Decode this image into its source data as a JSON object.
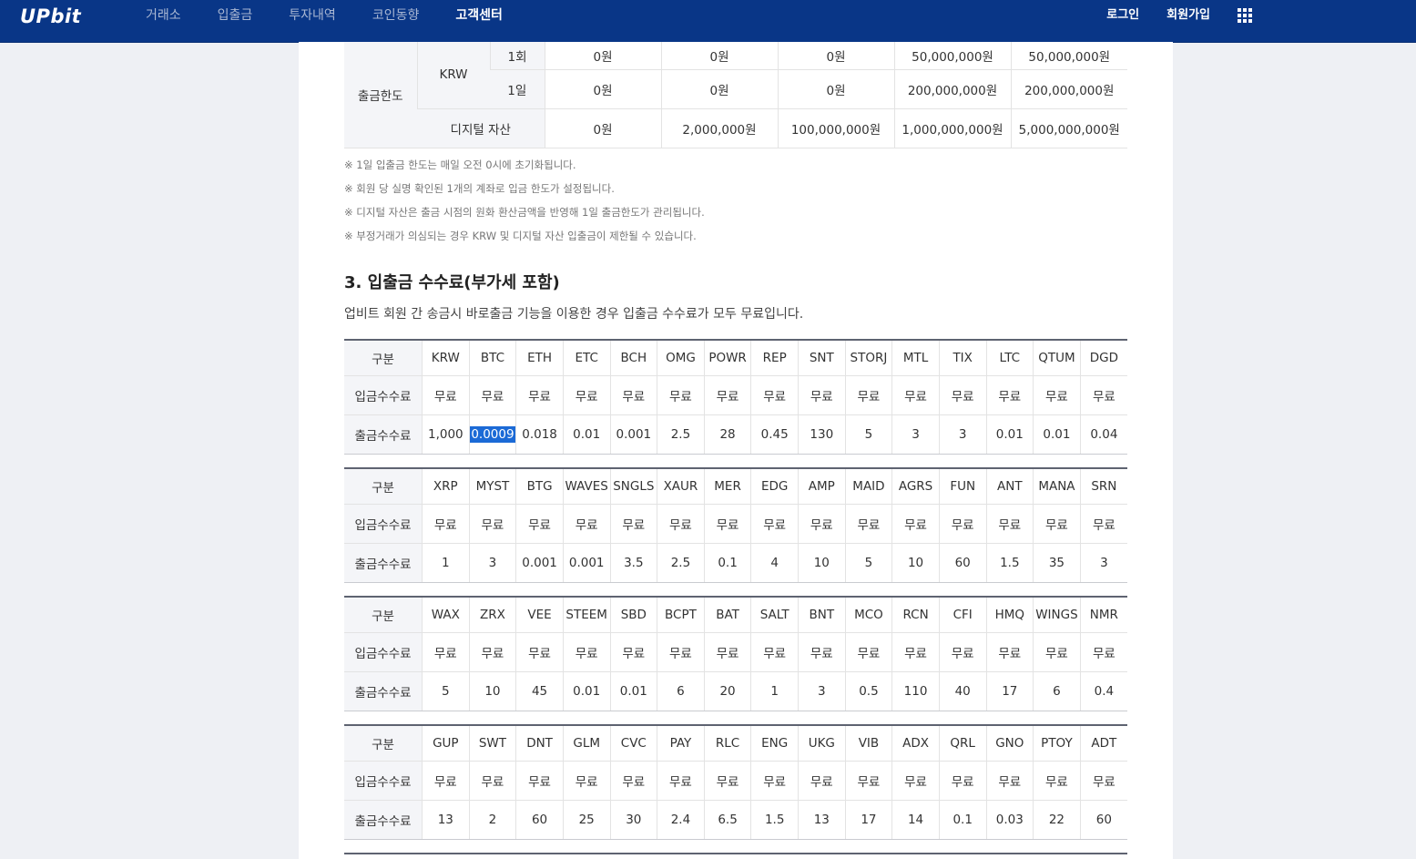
{
  "header": {
    "logo": "UPbit",
    "nav": [
      "거래소",
      "입출금",
      "투자내역",
      "코인동향",
      "고객센터"
    ],
    "active_nav": "고객센터",
    "login": "로그인",
    "signup": "회원가입",
    "apps_icon": "grid-icon"
  },
  "limit_table": {
    "row_title": "출금한도",
    "krw": "KRW",
    "once": "1회",
    "daily": "1일",
    "digital": "디지털 자산",
    "once_values": [
      "0원",
      "0원",
      "0원",
      "50,000,000원",
      "50,000,000원"
    ],
    "daily_values": [
      "0원",
      "0원",
      "0원",
      "200,000,000원",
      "200,000,000원"
    ],
    "digital_values": [
      "0원",
      "2,000,000원",
      "100,000,000원",
      "1,000,000,000원",
      "5,000,000,000원"
    ]
  },
  "notes": [
    "※ 1일 입출금 한도는 매일 오전 0시에 초기화됩니다.",
    "※ 회원 당 실명 확인된 1개의 계좌로 입금 한도가 설정됩니다.",
    "※ 디지털 자산은 출금 시점의 원화 환산금액을 반영해 1일 출금한도가 관리됩니다.",
    "※ 부정거래가 의심되는 경우 KRW 및 디지털 자산 입출금이 제한될 수 있습니다."
  ],
  "section_title": "3. 입출금 수수료(부가세 포함)",
  "section_desc": "업비트 회원 간 송금시 바로출금 기능을 이용한 경우 입출금 수수료가 모두 무료입니다.",
  "fee_labels": {
    "category": "구분",
    "deposit": "입금수수료",
    "withdraw": "출금수수료",
    "free": "무료"
  },
  "fee_tables": [
    {
      "coins": [
        "KRW",
        "BTC",
        "ETH",
        "ETC",
        "BCH",
        "OMG",
        "POWR",
        "REP",
        "SNT",
        "STORJ",
        "MTL",
        "TIX",
        "LTC",
        "QTUM",
        "DGD"
      ],
      "withdraw": [
        "1,000",
        "0.0009",
        "0.018",
        "0.01",
        "0.001",
        "2.5",
        "28",
        "0.45",
        "130",
        "5",
        "3",
        "3",
        "0.01",
        "0.01",
        "0.04"
      ]
    },
    {
      "coins": [
        "XRP",
        "MYST",
        "BTG",
        "WAVES",
        "SNGLS",
        "XAUR",
        "MER",
        "EDG",
        "AMP",
        "MAID",
        "AGRS",
        "FUN",
        "ANT",
        "MANA",
        "SRN"
      ],
      "withdraw": [
        "1",
        "3",
        "0.001",
        "0.001",
        "3.5",
        "2.5",
        "0.1",
        "4",
        "10",
        "5",
        "10",
        "60",
        "1.5",
        "35",
        "3"
      ]
    },
    {
      "coins": [
        "WAX",
        "ZRX",
        "VEE",
        "STEEM",
        "SBD",
        "BCPT",
        "BAT",
        "SALT",
        "BNT",
        "MCO",
        "RCN",
        "CFI",
        "HMQ",
        "WINGS",
        "NMR"
      ],
      "withdraw": [
        "5",
        "10",
        "45",
        "0.01",
        "0.01",
        "6",
        "20",
        "1",
        "3",
        "0.5",
        "110",
        "40",
        "17",
        "6",
        "0.4"
      ]
    },
    {
      "coins": [
        "GUP",
        "SWT",
        "DNT",
        "GLM",
        "CVC",
        "PAY",
        "RLC",
        "ENG",
        "UKG",
        "VIB",
        "ADX",
        "QRL",
        "GNO",
        "PTOY",
        "ADT"
      ],
      "withdraw": [
        "13",
        "2",
        "60",
        "25",
        "30",
        "2.4",
        "6.5",
        "1.5",
        "13",
        "17",
        "14",
        "0.1",
        "0.03",
        "22",
        "60"
      ]
    }
  ],
  "selected_cell": "0.0009"
}
